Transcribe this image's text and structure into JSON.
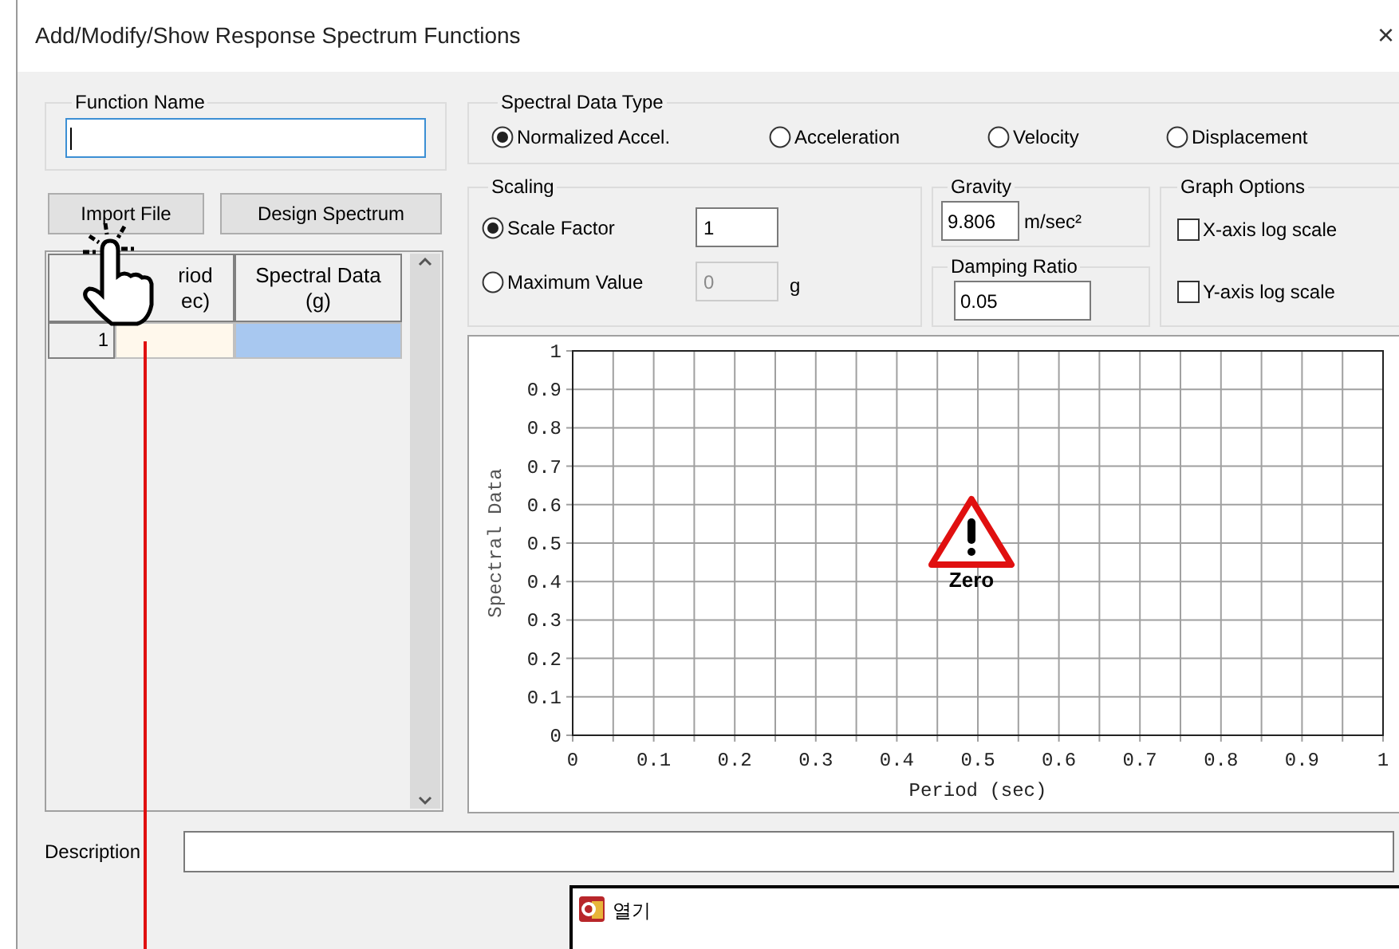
{
  "window": {
    "title": "Add/Modify/Show Response Spectrum Functions",
    "close": "×"
  },
  "function_name": {
    "label": "Function Name",
    "focused": true
  },
  "buttons": [
    {
      "label": "Import File"
    },
    {
      "label": "Design Spectrum"
    }
  ],
  "table": {
    "columns": [
      {
        "label": "riod",
        "unit": "ec)"
      },
      {
        "label": "Spectral Data",
        "unit": "(g)"
      }
    ],
    "rows": [
      {
        "number": "1",
        "cells": [
          {
            "active": true,
            "selected": false
          },
          {
            "active": false,
            "selected": true
          }
        ]
      }
    ]
  },
  "spectral_data_type": {
    "label": "Spectral Data Type",
    "options": [
      {
        "label": "Normalized Accel.",
        "selected": true
      },
      {
        "label": "Acceleration",
        "selected": false
      },
      {
        "label": "Velocity",
        "selected": false
      },
      {
        "label": "Displacement",
        "selected": false
      }
    ]
  },
  "scaling": {
    "label": "Scaling",
    "options": [
      {
        "label": "Scale Factor",
        "selected": true,
        "value": "1",
        "disabled": false
      },
      {
        "label": "Maximum Value",
        "selected": false,
        "value": "0",
        "unit": "g",
        "disabled": true
      }
    ]
  },
  "gravity": {
    "label": "Gravity",
    "value": "9.806",
    "unit": "m/sec²"
  },
  "damping_ratio": {
    "label": "Damping Ratio",
    "value": "0.05"
  },
  "graph_options": {
    "label": "Graph Options",
    "options": [
      {
        "label": "X-axis log scale",
        "checked": false
      },
      {
        "label": "Y-axis log scale",
        "checked": false
      }
    ]
  },
  "chart_data": {
    "type": "line",
    "xlabel": "Period (sec)",
    "ylabel": "Spectral Data",
    "xlim": [
      0,
      1
    ],
    "ylim": [
      0,
      1
    ],
    "xticks": [
      {
        "value": 0,
        "label": "0"
      },
      {
        "value": 0.1,
        "label": "0.1"
      },
      {
        "value": 0.2,
        "label": "0.2"
      },
      {
        "value": 0.3,
        "label": "0.3"
      },
      {
        "value": 0.4,
        "label": "0.4"
      },
      {
        "value": 0.5,
        "label": "0.5"
      },
      {
        "value": 0.6,
        "label": "0.6"
      },
      {
        "value": 0.7,
        "label": "0.7"
      },
      {
        "value": 0.8,
        "label": "0.8"
      },
      {
        "value": 0.9,
        "label": "0.9"
      },
      {
        "value": 1,
        "label": "1"
      }
    ],
    "yticks": [
      {
        "value": 0,
        "label": "0"
      },
      {
        "value": 0.1,
        "label": "0.1"
      },
      {
        "value": 0.2,
        "label": "0.2"
      },
      {
        "value": 0.3,
        "label": "0.3"
      },
      {
        "value": 0.4,
        "label": "0.4"
      },
      {
        "value": 0.5,
        "label": "0.5"
      },
      {
        "value": 0.6,
        "label": "0.6"
      },
      {
        "value": 0.7,
        "label": "0.7"
      },
      {
        "value": 0.8,
        "label": "0.8"
      },
      {
        "value": 0.9,
        "label": "0.9"
      },
      {
        "value": 1,
        "label": "1"
      }
    ],
    "grid": true,
    "annotations": [
      {
        "text": "Zero"
      }
    ]
  },
  "description": {
    "label": "Description"
  },
  "popup": {
    "title": "열기"
  }
}
